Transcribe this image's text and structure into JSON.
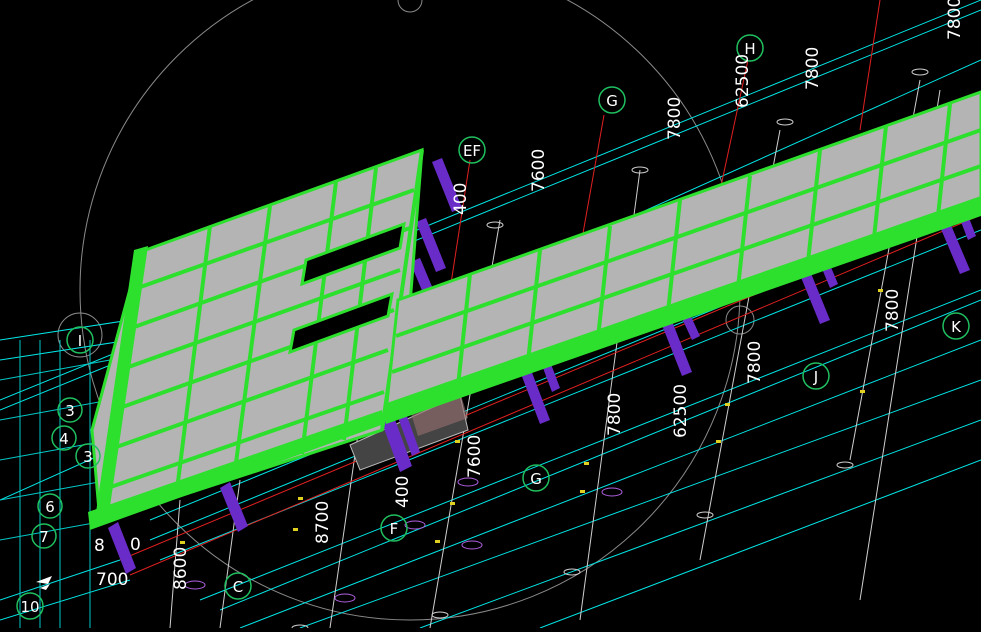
{
  "colors": {
    "background": "#000000",
    "axis_line": "#00e5e5",
    "slab_fill": "#b4b4b4",
    "beam_green": "#2ee02e",
    "column_purple": "#6a2cc8",
    "grid_bubble": "#1fbf5f",
    "red_line": "#e02020",
    "white_line": "#cfcfcf"
  },
  "grid_bubbles": {
    "h": "H",
    "g_top": "G",
    "ef_top": "EF",
    "i": "I",
    "k": "K",
    "j": "J",
    "g_bottom": "G",
    "f_bottom": "F",
    "c": "C",
    "three": "3",
    "four": "4",
    "three_b": "3",
    "six": "6",
    "seven": "7",
    "ten": "10"
  },
  "dimensions": {
    "d7800_a": "7800",
    "d7800_b": "7800",
    "d62500_top": "62500",
    "d7600_top": "7600",
    "d400_top": "400",
    "d7800_c": "7800",
    "d7800_d": "7800",
    "d7800_e": "7800",
    "d62500_mid": "62500",
    "d7600_mid": "7600",
    "d400_mid": "400",
    "d8700": "8700",
    "d8600": "8600",
    "d8_left": "8",
    "d700_left": "700",
    "d0_left": "0"
  }
}
